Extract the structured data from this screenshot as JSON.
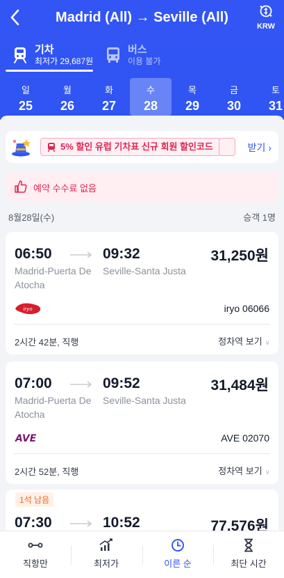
{
  "header": {
    "route": "Madrid (All) → Seville (All)",
    "currency": "KRW"
  },
  "mode_tabs": [
    {
      "name": "기차",
      "sub": "최저가 29,687원",
      "active": true,
      "icon": "train-icon"
    },
    {
      "name": "버스",
      "sub": "이용 불가",
      "active": false,
      "icon": "bus-icon"
    }
  ],
  "dates": [
    {
      "weekday": "일",
      "day": "25"
    },
    {
      "weekday": "월",
      "day": "26"
    },
    {
      "weekday": "화",
      "day": "27"
    },
    {
      "weekday": "수",
      "day": "28",
      "selected": true
    },
    {
      "weekday": "목",
      "day": "29"
    },
    {
      "weekday": "금",
      "day": "30"
    },
    {
      "weekday": "토",
      "day": "31"
    }
  ],
  "promo": {
    "chip": "5% 할인 유럽 기차표 신규 회원 할인코드",
    "link": "받기"
  },
  "no_fee": "예약 수수료 없음",
  "trip_date": "8월28일(수)",
  "passengers": "승객 1명",
  "trains": [
    {
      "dep_time": "06:50",
      "arr_time": "09:32",
      "price": "31,250원",
      "dep_station": "Madrid-Puerta De Atocha",
      "arr_station": "Seville-Santa Justa",
      "operator": "iryo",
      "train_no": "iryo 06066",
      "duration": "2시간 42분, 직행",
      "stops": "정차역 보기"
    },
    {
      "dep_time": "07:00",
      "arr_time": "09:52",
      "price": "31,484원",
      "dep_station": "Madrid-Puerta De Atocha",
      "arr_station": "Seville-Santa Justa",
      "operator": "AVE",
      "train_no": "AVE 02070",
      "duration": "2시간 52분, 직행",
      "stops": "정차역 보기"
    },
    {
      "badge": "1석 남음",
      "dep_time": "07:30",
      "arr_time": "10:52",
      "price": "77,576원"
    }
  ],
  "bottom_nav": [
    {
      "label": "직항만",
      "icon": "direct-icon",
      "active": false
    },
    {
      "label": "최저가",
      "icon": "price-trend-icon",
      "active": false
    },
    {
      "label": "이른 순",
      "icon": "clock-icon",
      "active": true
    },
    {
      "label": "최단 시간",
      "icon": "hourglass-icon",
      "active": false
    }
  ],
  "colors": {
    "brand": "#2f55f2",
    "accent_red": "#e0254f",
    "iryo": "#d51f2f",
    "ave": "#7b1a73"
  }
}
